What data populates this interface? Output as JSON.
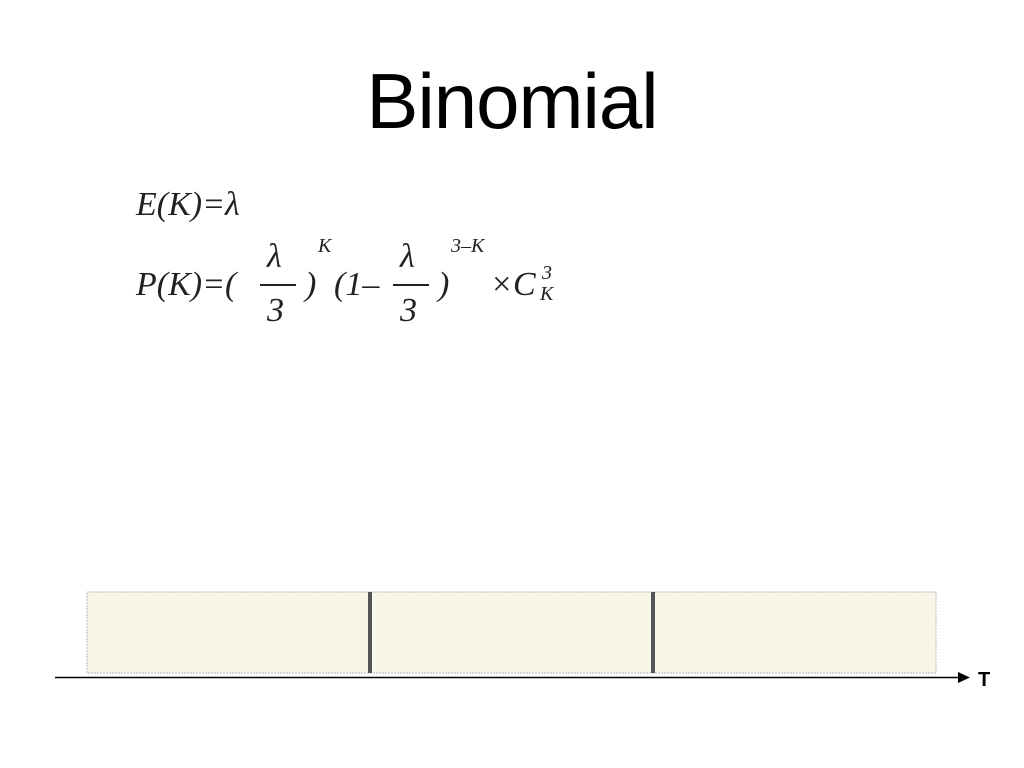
{
  "slide": {
    "title": "Binomial"
  },
  "formulas": {
    "expectation": "E(K)=λ",
    "probability": {
      "lhs": "P(K)=(",
      "lambda_1": "λ",
      "denom_1": "3",
      "close_1": ")",
      "exp_1": "K",
      "open_2": "(1–",
      "lambda_2": "λ",
      "denom_2": "3",
      "close_2": ")",
      "exp_2": "3–K",
      "times_c": "×C",
      "c_sup": "3",
      "c_sub": "K"
    }
  },
  "timeline": {
    "axis_label": "T",
    "segments": 3,
    "colors": {
      "segment_fill": "#f8f5e9",
      "segment_border": "#b8b8b8",
      "divider": "#555555",
      "axis": "#000000"
    }
  }
}
